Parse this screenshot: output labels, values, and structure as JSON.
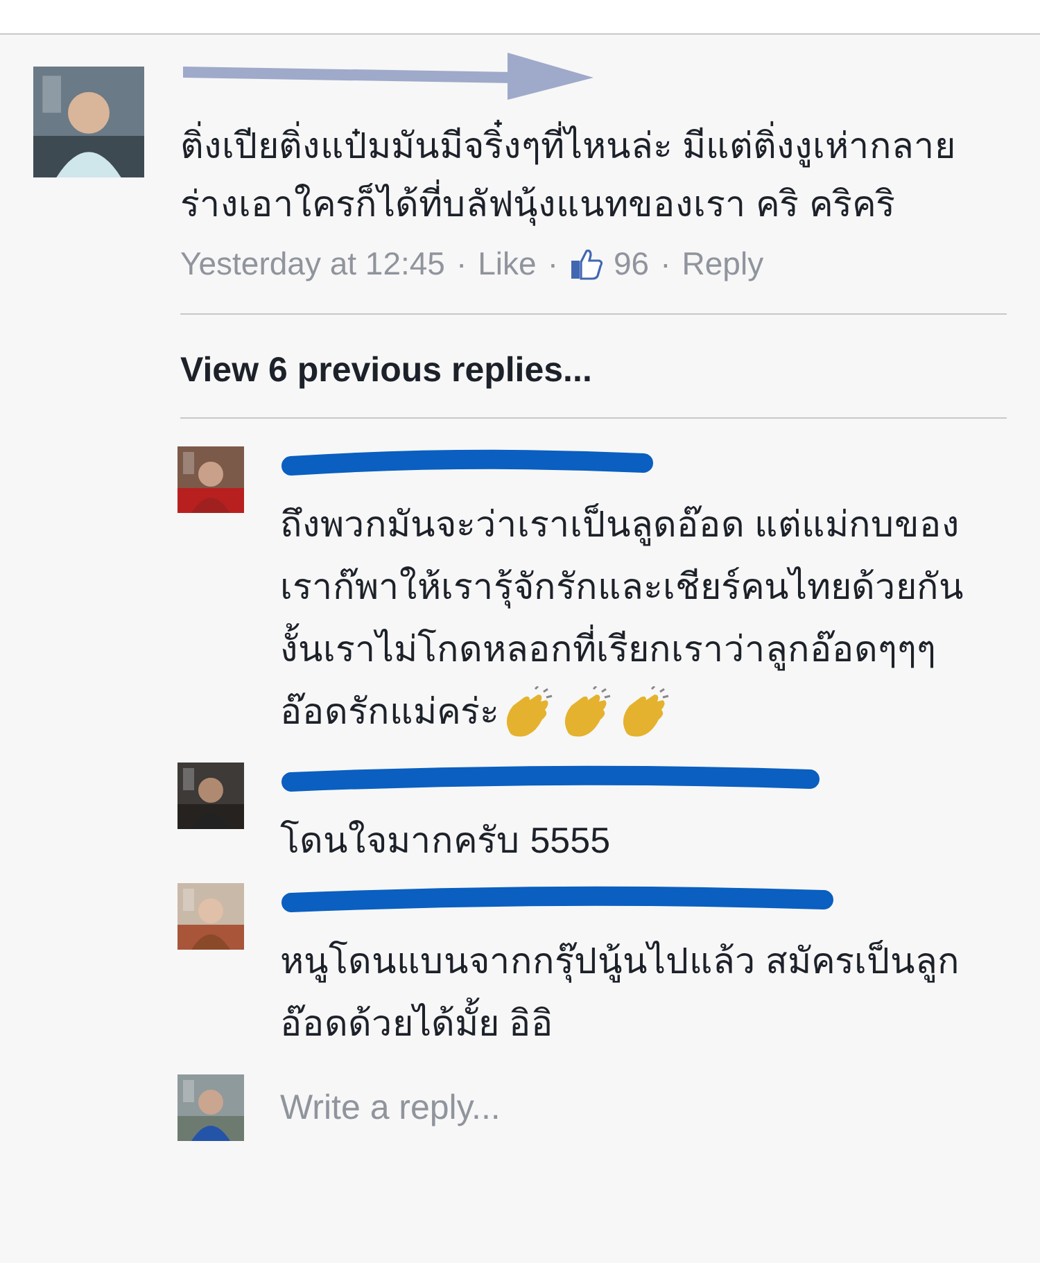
{
  "comment": {
    "text": "ติ่งเปียติ่งแป๋มมันมีจริ๋งๆที่ไหนล่ะ มีแต่ติ่งงูเห่ากลายร่างเอาใครก็ได้ที่บลัฟนุ้งแนทของเรา คริ คริคริ",
    "time": "Yesterday at 12:45",
    "like": "Like",
    "likes": "96",
    "reply": "Reply",
    "separator": "·"
  },
  "view_previous": "View 6 previous replies...",
  "replies": [
    {
      "kind": "applause",
      "text": "ถึงพวกมันจะว่าเราเป็นลูดอ๊อด แต่แม่กบของเราก๊พาให้เรารุ้จักรักและเชียร์คนไทยด้วยกัน งั้นเราไม่โกดหลอกที่เรียกเราว่าลูกอ๊อดๆๆๆ อ๊อดรักแม่คร่ะ"
    },
    {
      "kind": "plain",
      "text": "โดนใจมากครับ 5555"
    },
    {
      "kind": "plain",
      "text": "หนูโดนแบนจากกรุ๊ปนู้นไปแล้ว สมัครเป็นลูกอ๊อดด้วยได้มั้ย อิอิ"
    }
  ],
  "reply_field": {
    "placeholder": "Write a reply..."
  }
}
